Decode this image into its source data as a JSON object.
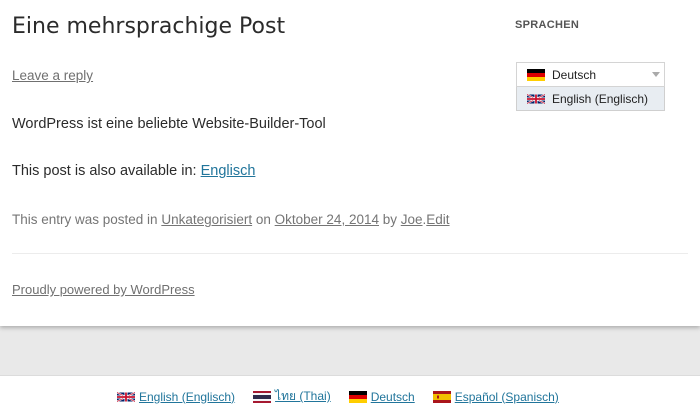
{
  "post": {
    "title": "Eine mehrsprachige Post",
    "leave_reply": "Leave a reply",
    "content": "WordPress ist eine beliebte Website-Builder-Tool",
    "available_prefix": "This post is also available in: ",
    "available_link": "Englisch",
    "meta": {
      "posted_in": "This entry was posted in ",
      "category": "Unkategorisiert",
      "on": " on ",
      "date": "Oktober 24, 2014",
      "by": " by ",
      "author": "Joe",
      "dot": ".",
      "edit": "Edit"
    }
  },
  "footer": {
    "powered": "Proudly powered by WordPress"
  },
  "widget": {
    "title": "SPRACHEN",
    "selected": {
      "label": "Deutsch",
      "flag": "de-flag-icon"
    },
    "option": {
      "label": "English (Englisch)",
      "flag": "gb-flag-icon"
    }
  },
  "language_bar": [
    {
      "label": "English (Englisch)",
      "flag": "gb-flag-icon"
    },
    {
      "label": "ไทย (Thai)",
      "flag": "th-flag-icon"
    },
    {
      "label": "Deutsch",
      "flag": "de-flag-icon"
    },
    {
      "label": "Español (Spanisch)",
      "flag": "es-flag-icon"
    }
  ],
  "colors": {
    "link": "#21759b",
    "muted": "#757575",
    "background": "#e9e9e9"
  }
}
